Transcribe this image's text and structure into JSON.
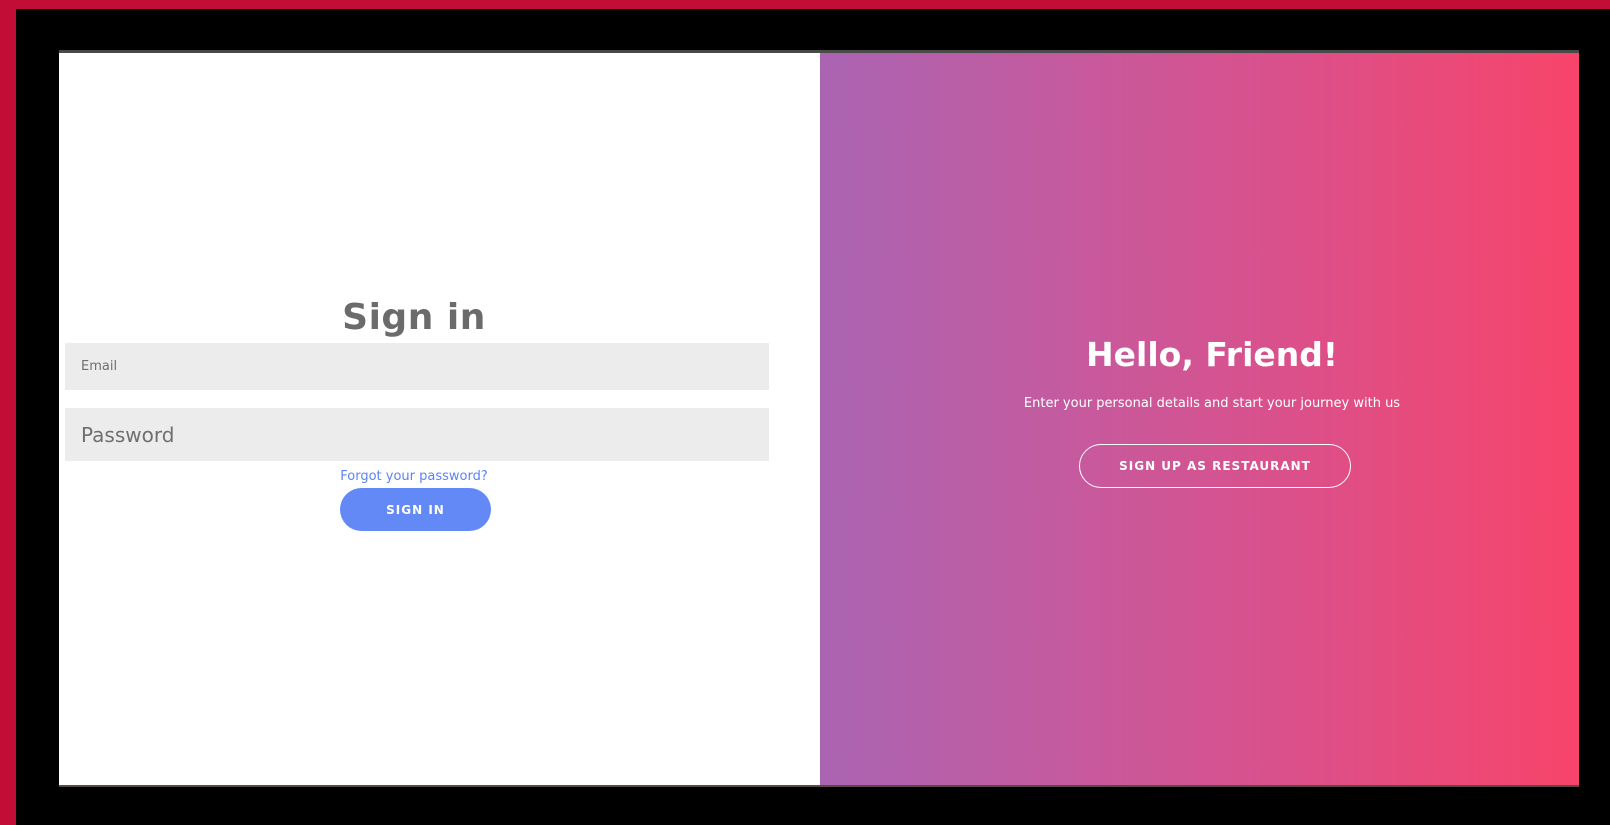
{
  "sign_in_panel": {
    "title": "Sign in",
    "email_placeholder": "Email",
    "password_placeholder": "Password",
    "forgot_password_link": "Forgot your password?",
    "sign_in_button": "SIGN IN"
  },
  "welcome_panel": {
    "title": "Hello, Friend!",
    "subtitle": "Enter your personal details and start your journey with us",
    "sign_up_button": "SIGN UP AS RESTAURANT"
  },
  "colors": {
    "outer_border": "#c20d37",
    "primary_button": "#6389f7",
    "link": "#5b84f5",
    "gradient_start": "#aa64b2",
    "gradient_end": "#f7446a"
  }
}
